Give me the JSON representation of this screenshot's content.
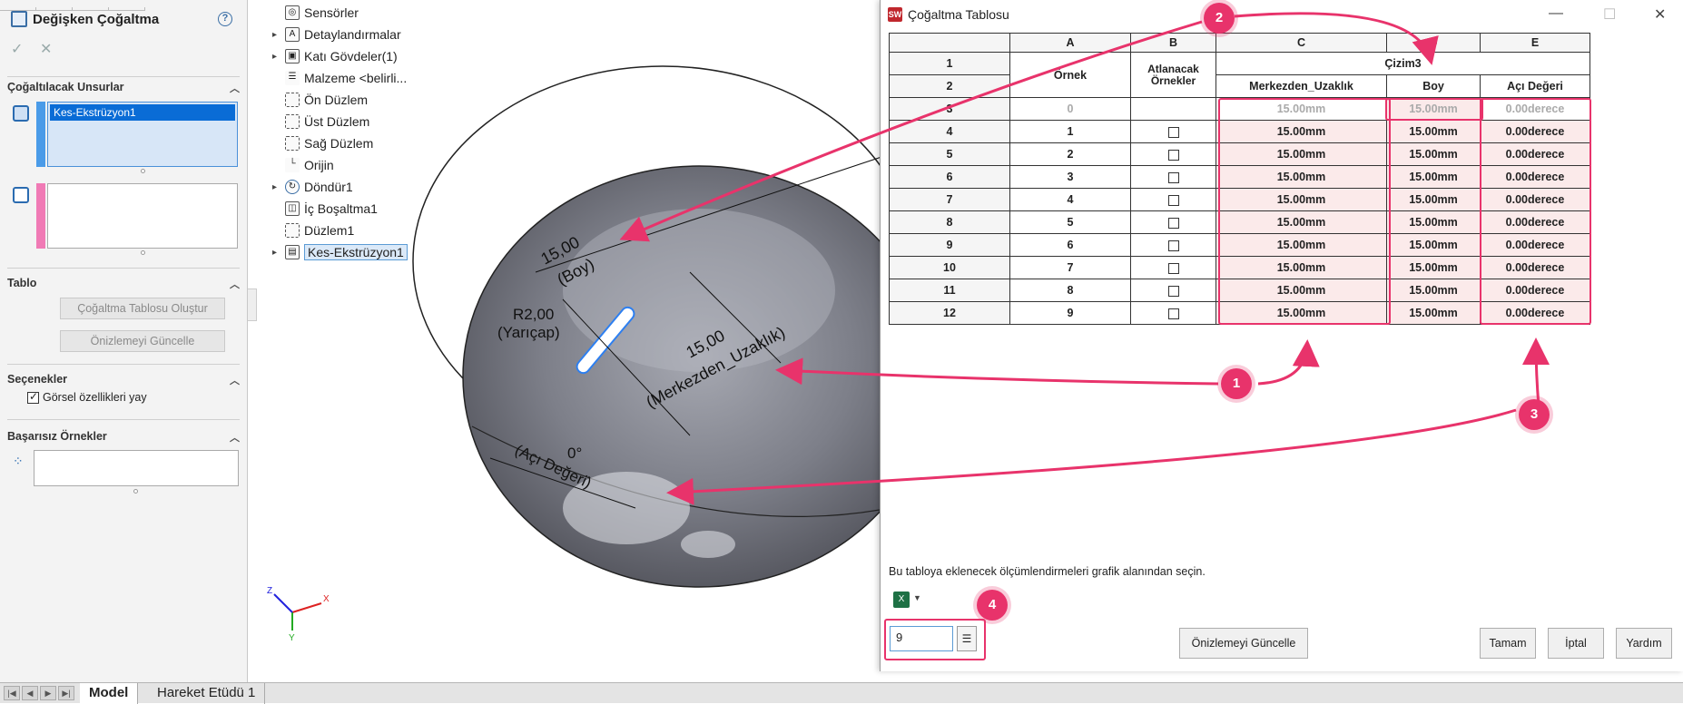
{
  "pm": {
    "title": "Değişken Çoğaltma",
    "help": "?",
    "sections": {
      "features": "Çoğaltılacak Unsurlar",
      "table": "Tablo",
      "options": "Seçenekler",
      "failed": "Başarısız Örnekler"
    },
    "selected_feature": "Kes-Ekstrüzyon1",
    "buttons": {
      "create_table": "Çoğaltma Tablosu Oluştur",
      "update_preview": "Önizlemeyi Güncelle"
    },
    "option_visual": "Görsel özellikleri yay"
  },
  "tree": {
    "items": [
      {
        "label": "Sensörler"
      },
      {
        "label": "Detaylandırmalar"
      },
      {
        "label": "Katı Gövdeler(1)"
      },
      {
        "label": "Malzeme <belirli..."
      },
      {
        "label": "Ön Düzlem"
      },
      {
        "label": "Üst Düzlem"
      },
      {
        "label": "Sağ Düzlem"
      },
      {
        "label": "Orijin"
      },
      {
        "label": "Döndür1"
      },
      {
        "label": "İç Boşaltma1"
      },
      {
        "label": "Düzlem1"
      },
      {
        "label": "Kes-Ekstrüzyon1"
      }
    ]
  },
  "viewport": {
    "dims": {
      "boy_value": "15,00",
      "boy_name": "(Boy)",
      "radius_value": "R2,00",
      "radius_name": "(Yarıçap)",
      "merk_value": "15,00",
      "merk_name": "(Merkezden_Uzaklık)",
      "angle_value": "0°",
      "angle_name": "(Açı Değeri)"
    },
    "axes": {
      "x": "X",
      "y": "Y",
      "z": "Z"
    }
  },
  "dialog": {
    "title": "Çoğaltma Tablosu",
    "columns": [
      "A",
      "B",
      "C",
      "D",
      "E"
    ],
    "row1_label": "1",
    "row2_label": "2",
    "h_ornek": "Örnek",
    "h_atlanacak": "Atlanacak Örnekler",
    "h_cizim": "Çizim3",
    "h_merk": "Merkezden_Uzaklık",
    "h_boy": "Boy",
    "h_aci": "Açı Değeri",
    "rows": [
      {
        "num": "3",
        "ornek": "0",
        "merk": "15.00mm",
        "boy": "15.00mm",
        "aci": "0.00derece"
      },
      {
        "num": "4",
        "ornek": "1",
        "merk": "15.00mm",
        "boy": "15.00mm",
        "aci": "0.00derece"
      },
      {
        "num": "5",
        "ornek": "2",
        "merk": "15.00mm",
        "boy": "15.00mm",
        "aci": "0.00derece"
      },
      {
        "num": "6",
        "ornek": "3",
        "merk": "15.00mm",
        "boy": "15.00mm",
        "aci": "0.00derece"
      },
      {
        "num": "7",
        "ornek": "4",
        "merk": "15.00mm",
        "boy": "15.00mm",
        "aci": "0.00derece"
      },
      {
        "num": "8",
        "ornek": "5",
        "merk": "15.00mm",
        "boy": "15.00mm",
        "aci": "0.00derece"
      },
      {
        "num": "9",
        "ornek": "6",
        "merk": "15.00mm",
        "boy": "15.00mm",
        "aci": "0.00derece"
      },
      {
        "num": "10",
        "ornek": "7",
        "merk": "15.00mm",
        "boy": "15.00mm",
        "aci": "0.00derece"
      },
      {
        "num": "11",
        "ornek": "8",
        "merk": "15.00mm",
        "boy": "15.00mm",
        "aci": "0.00derece"
      },
      {
        "num": "12",
        "ornek": "9",
        "merk": "15.00mm",
        "boy": "15.00mm",
        "aci": "0.00derece"
      }
    ],
    "hint": "Bu tabloya eklenecek ölçümlendirmeleri grafik alanından seçin.",
    "count_value": "9",
    "buttons": {
      "preview": "Önizlemeyi Güncelle",
      "ok": "Tamam",
      "cancel": "İptal",
      "help": "Yardım"
    }
  },
  "callouts": [
    "1",
    "2",
    "3",
    "4"
  ],
  "bottom_tabs": [
    "Model",
    "Hareket Etüdü 1"
  ],
  "colors": {
    "accent": "#e8336b",
    "selection": "#0a6cd6",
    "table_tint": "#fbeaea"
  }
}
